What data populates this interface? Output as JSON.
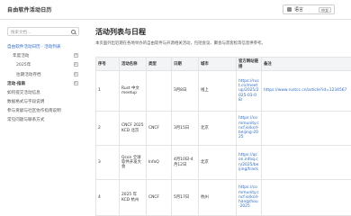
{
  "header": {
    "site_title": "自由软件活动日历",
    "language_label": "语言",
    "language_select": "中文"
  },
  "sidebar": {
    "search_placeholder": "搜索文档…",
    "items": [
      {
        "label": "自由软件活动日历 · 活动列表",
        "state": "active"
      },
      {
        "label": "年度活动",
        "state": "normal"
      },
      {
        "label": "2025年",
        "state": "normal"
      },
      {
        "label": "往期活动存档",
        "state": "normal"
      },
      {
        "label": "活动·指南",
        "state": "bold"
      },
      {
        "label": "如何提交活动信息",
        "state": "normal"
      },
      {
        "label": "数据格式与字段说明",
        "state": "normal"
      },
      {
        "label": "参与贡献与社区协作指南说明",
        "state": "normal"
      },
      {
        "label": "常见问题与联系方式",
        "state": "normal"
      }
    ]
  },
  "main": {
    "title": "活动列表与日程",
    "description": "本页面列出近期在各地举办的自由软件与开源相关活动，包括会议、聚会与黑客松等信息供参考。",
    "columns": [
      "序号",
      "活动名称",
      "类型",
      "日期",
      "城市",
      "官方网站链接",
      "备注"
    ],
    "rows": [
      {
        "no": "1",
        "name": "Rust 中文 meetup",
        "type": "",
        "date": "3月8日",
        "city": "线上",
        "url": "https://rust.cn/meetup/2025/2025-03-08/",
        "note": "https://www.rustcc.cn/article?id=1234567"
      },
      {
        "no": "2",
        "name": "CNCF 2025 KCD 北京",
        "type": "CNCF",
        "date": "3月15日",
        "city": "北京",
        "url": "https://community.cncf.io/kcd-beijing-2025",
        "note": ""
      },
      {
        "no": "3",
        "name": "Qcon 全球软件开发大会",
        "type": "InfoQ",
        "date": "4月10日-4月12日",
        "city": "北京",
        "url": "https://qcon.infoq.cn/2025/beijing/track",
        "note": ""
      },
      {
        "no": "4",
        "name": "2025 年 KCD 杭州",
        "type": "CNCF",
        "date": "5月17日",
        "city": "杭州",
        "url": "https://community.cncf.io/kcd-hangzhou-2025",
        "note": ""
      }
    ]
  }
}
